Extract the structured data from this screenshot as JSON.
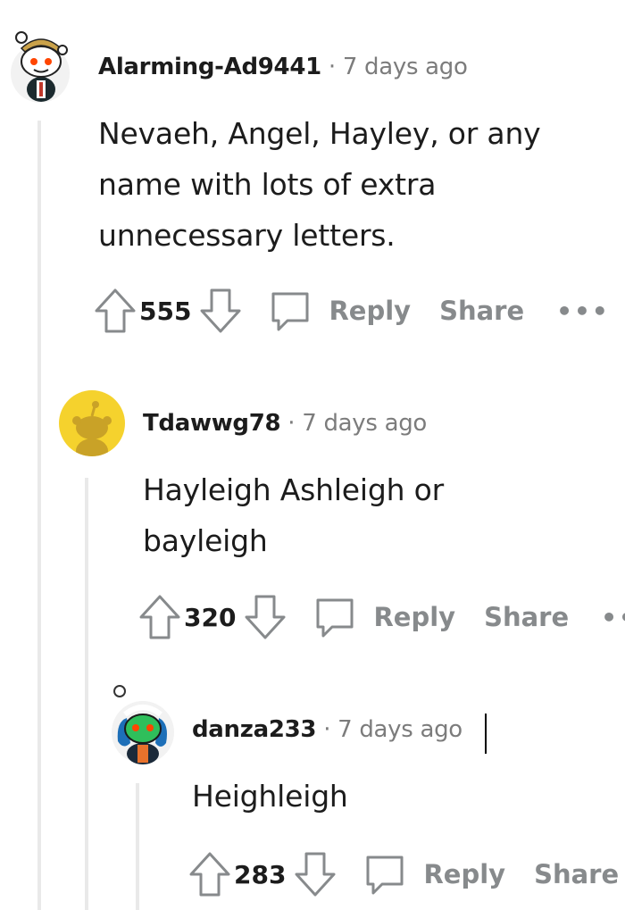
{
  "comments": [
    {
      "username": "Alarming-Ad9441",
      "separator": "·",
      "time": "7 days ago",
      "lines": [
        "Nevaeh, Angel, Hayley, or any",
        "name with lots of extra",
        "unnecessary letters."
      ],
      "score": "555",
      "reply_label": "Reply",
      "share_label": "Share",
      "more_label": "•••"
    },
    {
      "username": "Tdawwg78",
      "separator": "·",
      "time": "7 days ago",
      "lines": [
        "Hayleigh Ashleigh or",
        "bayleigh"
      ],
      "score": "320",
      "reply_label": "Reply",
      "share_label": "Share",
      "more_label": "•••"
    },
    {
      "username": "danza233",
      "separator": "·",
      "time": "7 days ago",
      "lines": [
        "Heighleigh"
      ],
      "score": "283",
      "reply_label": "Reply",
      "share_label": "Share"
    }
  ],
  "colors": {
    "text": "#1c1c1c",
    "muted": "#7c7c7c",
    "action": "#878a8c",
    "thread_line": "#e9e9e9",
    "avatar_yellow": "#f5d22d",
    "snoo_red": "#ff4500"
  },
  "icons": [
    "upvote-icon",
    "downvote-icon",
    "reply-bubble-icon",
    "snoo-avatar-icon"
  ]
}
